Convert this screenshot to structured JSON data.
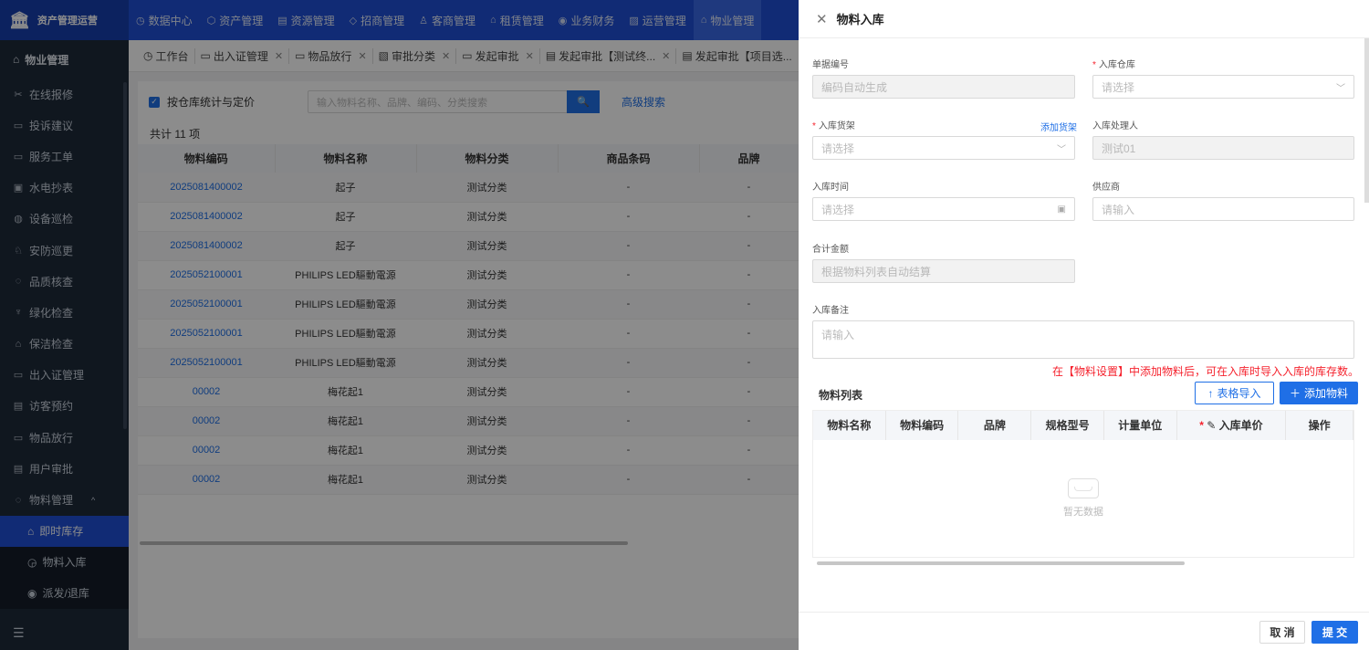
{
  "app": {
    "brand": "资产管理运营"
  },
  "topnav": [
    {
      "label": "数据中心",
      "icon": "dashboard-icon",
      "glyph": "◷"
    },
    {
      "label": "资产管理",
      "icon": "cube-icon",
      "glyph": "⬡"
    },
    {
      "label": "资源管理",
      "icon": "building-icon",
      "glyph": "▤"
    },
    {
      "label": "招商管理",
      "icon": "diamond-icon",
      "glyph": "◇"
    },
    {
      "label": "客商管理",
      "icon": "users-icon",
      "glyph": "♙"
    },
    {
      "label": "租赁管理",
      "icon": "house-icon",
      "glyph": "⌂"
    },
    {
      "label": "业务财务",
      "icon": "money-icon",
      "glyph": "◉"
    },
    {
      "label": "运营管理",
      "icon": "chart-icon",
      "glyph": "▨"
    },
    {
      "label": "物业管理",
      "icon": "property-icon",
      "glyph": "⌂"
    }
  ],
  "sidebar": {
    "header": "物业管理",
    "items": [
      {
        "label": "在线报修",
        "icon": "wrench-icon",
        "glyph": "✂"
      },
      {
        "label": "投诉建议",
        "icon": "message-icon",
        "glyph": "▭"
      },
      {
        "label": "服务工单",
        "icon": "ticket-icon",
        "glyph": "▭"
      },
      {
        "label": "水电抄表",
        "icon": "meter-icon",
        "glyph": "▣"
      },
      {
        "label": "设备巡检",
        "icon": "device-icon",
        "glyph": "◍"
      },
      {
        "label": "安防巡更",
        "icon": "shield-icon",
        "glyph": "♘"
      },
      {
        "label": "品质核查",
        "icon": "check-icon",
        "glyph": "◌"
      },
      {
        "label": "绿化检查",
        "icon": "plant-icon",
        "glyph": "♆"
      },
      {
        "label": "保洁检查",
        "icon": "broom-icon",
        "glyph": "⌂"
      },
      {
        "label": "出入证管理",
        "icon": "pass-icon",
        "glyph": "▭"
      },
      {
        "label": "访客预约",
        "icon": "visitor-icon",
        "glyph": "▤"
      },
      {
        "label": "物品放行",
        "icon": "box-icon",
        "glyph": "▭"
      },
      {
        "label": "用户审批",
        "icon": "approve-icon",
        "glyph": "▤"
      }
    ],
    "group": {
      "label": "物料管理",
      "icon": "material-icon",
      "glyph": "◌",
      "caret": "^"
    },
    "subitems": [
      {
        "label": "即时库存",
        "icon": "inventory-icon",
        "glyph": "⌂",
        "active": true
      },
      {
        "label": "物料入库",
        "icon": "inbound-icon",
        "glyph": "◶",
        "active": false
      },
      {
        "label": "派发/退库",
        "icon": "dispatch-icon",
        "glyph": "◉",
        "active": false
      }
    ],
    "footer_icon": "menu-fold-icon",
    "footer_glyph": "☰"
  },
  "tabs": [
    {
      "label": "工作台",
      "glyph": "◷",
      "closable": false
    },
    {
      "label": "出入证管理",
      "glyph": "▭",
      "closable": true
    },
    {
      "label": "物品放行",
      "glyph": "▭",
      "closable": true
    },
    {
      "label": "审批分类",
      "glyph": "▧",
      "closable": true
    },
    {
      "label": "发起审批",
      "glyph": "▭",
      "closable": true
    },
    {
      "label": "发起审批【测试终...",
      "glyph": "▤",
      "closable": true
    },
    {
      "label": "发起审批【项目选...",
      "glyph": "▤",
      "closable": true
    }
  ],
  "filter": {
    "checkbox_label": "按仓库统计与定价",
    "checkbox_checked": true,
    "search_placeholder": "输入物料名称、品牌、编码、分类搜索",
    "advanced_label": "高级搜索"
  },
  "list": {
    "count_text": "共计 11 项",
    "columns": [
      "物料编码",
      "物料名称",
      "物料分类",
      "商品条码",
      "品牌"
    ],
    "rows": [
      [
        "2025081400002",
        "起子",
        "测试分类",
        "-",
        "-"
      ],
      [
        "2025081400002",
        "起子",
        "测试分类",
        "-",
        "-"
      ],
      [
        "2025081400002",
        "起子",
        "测试分类",
        "-",
        "-"
      ],
      [
        "2025052100001",
        "PHILIPS LED驅動電源",
        "测试分类",
        "-",
        "-"
      ],
      [
        "2025052100001",
        "PHILIPS LED驅動電源",
        "测试分类",
        "-",
        "-"
      ],
      [
        "2025052100001",
        "PHILIPS LED驅動電源",
        "测试分类",
        "-",
        "-"
      ],
      [
        "2025052100001",
        "PHILIPS LED驅動電源",
        "测试分类",
        "-",
        "-"
      ],
      [
        "00002",
        "梅花起1",
        "测试分类",
        "-",
        "-"
      ],
      [
        "00002",
        "梅花起1",
        "测试分类",
        "-",
        "-"
      ],
      [
        "00002",
        "梅花起1",
        "测试分类",
        "-",
        "-"
      ],
      [
        "00002",
        "梅花起1",
        "测试分类",
        "-",
        "-"
      ]
    ]
  },
  "drawer": {
    "title": "物料入库",
    "fields": {
      "doc_no": {
        "label": "单据编号",
        "value": "编码自动生成"
      },
      "warehouse": {
        "label": "入库仓库",
        "placeholder": "请选择"
      },
      "shelf": {
        "label": "入库货架",
        "placeholder": "请选择",
        "link": "添加货架"
      },
      "handler": {
        "label": "入库处理人",
        "value": "测试01"
      },
      "time": {
        "label": "入库时间",
        "placeholder": "请选择"
      },
      "supplier": {
        "label": "供应商",
        "placeholder": "请输入"
      },
      "total": {
        "label": "合计金额",
        "value": "根据物料列表自动结算"
      },
      "remark": {
        "label": "入库备注",
        "placeholder": "请输入"
      }
    },
    "hint": "在【物料设置】中添加物料后，可在入库时导入入库的库存数。",
    "material_list": {
      "title": "物料列表",
      "import_label": "表格导入",
      "add_label": "添加物料",
      "columns": [
        "物料名称",
        "物料编码",
        "品牌",
        "规格型号",
        "计量单位",
        "入库单价",
        "操作"
      ],
      "empty_text": "暂无数据"
    },
    "cancel_label": "取 消",
    "submit_label": "提 交"
  },
  "colors": {
    "primary": "#1f6fe6",
    "topbar": "#1f4fd6",
    "sidebar": "#1e2a3a",
    "required": "#f5222d"
  }
}
